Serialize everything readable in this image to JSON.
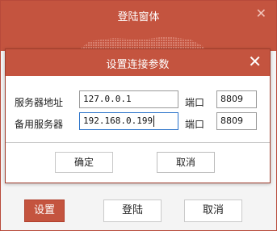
{
  "outer_window": {
    "title": "登陆窗体",
    "close_glyph": "✕",
    "buttons": {
      "settings": "设置",
      "login": "登陆",
      "cancel": "取消"
    }
  },
  "dialog": {
    "title": "设置连接参数",
    "close_glyph": "✕",
    "server_label": "服务器地址",
    "server_value": "127.0.0.1",
    "server_port_label": "端口",
    "server_port_value": "8809",
    "backup_label": "备用服务器",
    "backup_value": "192.168.0.199",
    "backup_port_label": "端口",
    "backup_port_value": "8809",
    "ok_label": "确定",
    "cancel_label": "取消"
  },
  "colors": {
    "accent": "#c4543f",
    "focus_border": "#2b73c9"
  }
}
